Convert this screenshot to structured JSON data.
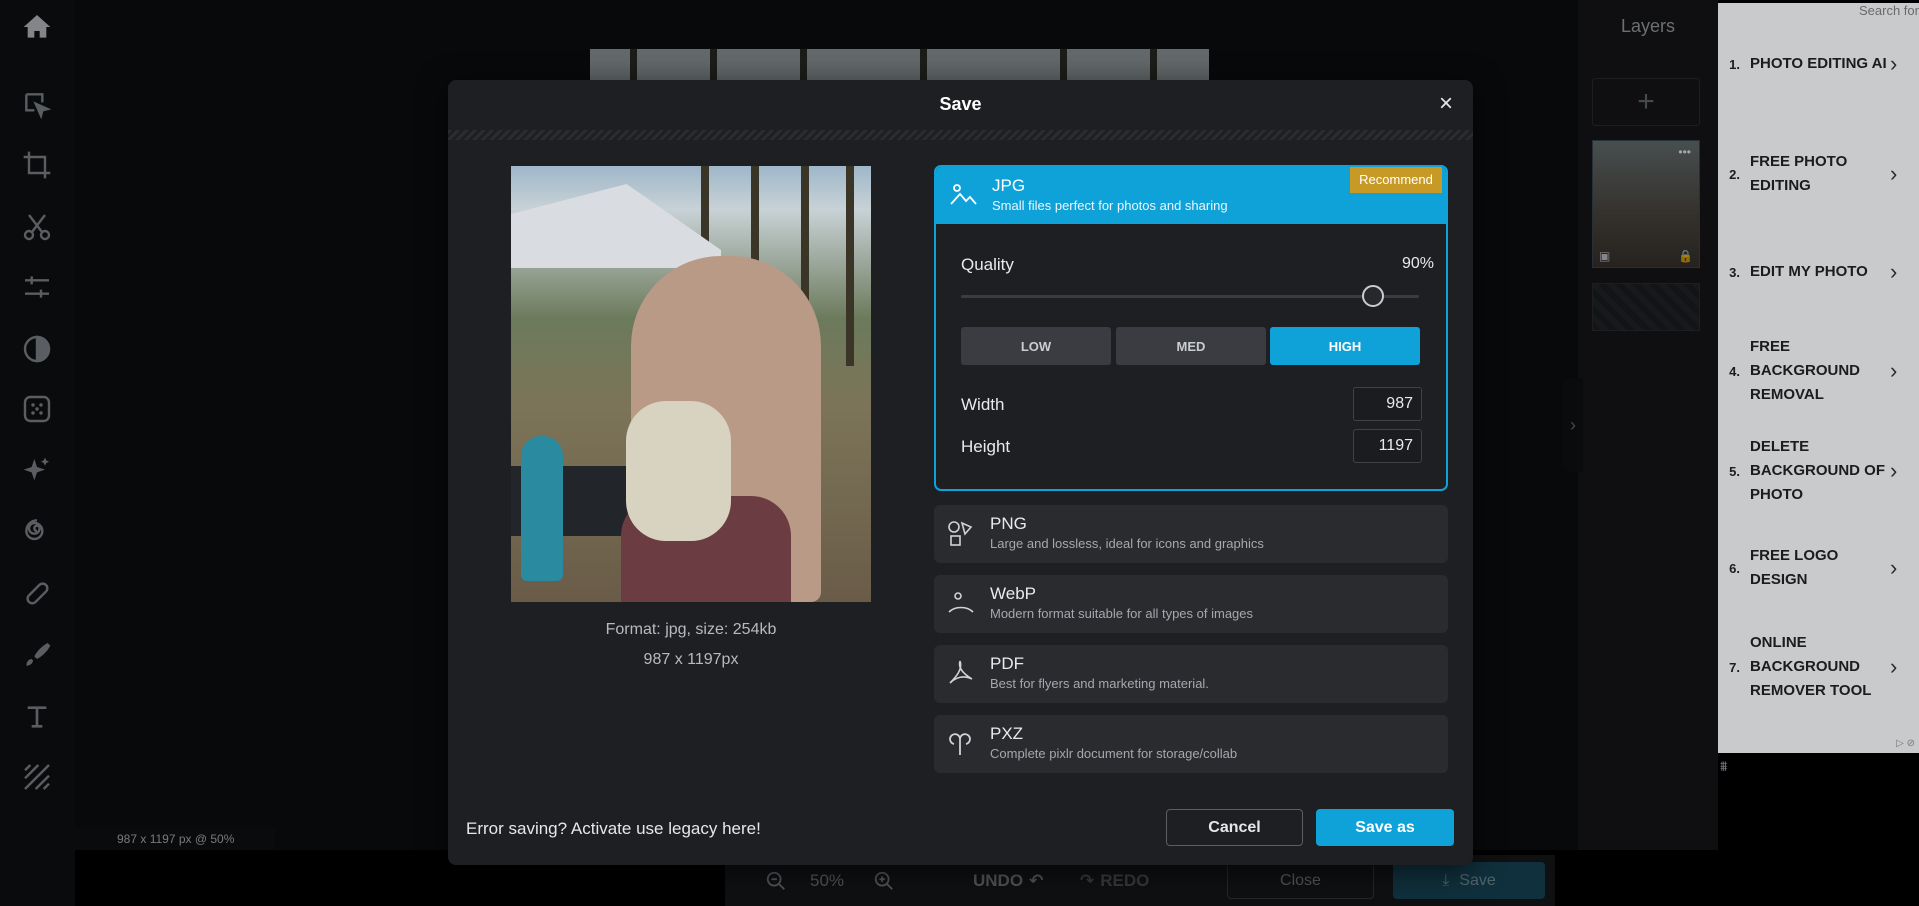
{
  "canvas": {
    "status": "987 x 1197 px @ 50%"
  },
  "bottom_bar": {
    "zoom": "50%",
    "undo": "UNDO",
    "redo": "REDO",
    "close": "Close",
    "save": "Save"
  },
  "layers": {
    "title": "Layers",
    "add": "+",
    "thumb_menu": "•••"
  },
  "ad": {
    "search": "Search for",
    "items": [
      {
        "num": "1.",
        "label": "PHOTO EDITING AI"
      },
      {
        "num": "2.",
        "label": "FREE PHOTO EDITING"
      },
      {
        "num": "3.",
        "label": "EDIT MY PHOTO"
      },
      {
        "num": "4.",
        "label": "FREE BACKGROUND REMOVAL"
      },
      {
        "num": "5.",
        "label": "DELETE BACKGROUND OF PHOTO"
      },
      {
        "num": "6.",
        "label": "FREE LOGO DESIGN"
      },
      {
        "num": "7.",
        "label": "ONLINE BACKGROUND REMOVER TOOL"
      }
    ]
  },
  "dialog": {
    "title": "Save",
    "close": "×",
    "preview": {
      "format_size": "Format: jpg, size: 254kb",
      "dimensions": "987 x 1197px"
    },
    "jpg": {
      "name": "JPG",
      "desc": "Small files perfect for photos and sharing",
      "badge": "Recommend",
      "quality_label": "Quality",
      "quality_value": "90%",
      "quality": 0.9,
      "presets": [
        "LOW",
        "MED",
        "HIGH"
      ],
      "active_preset": "HIGH",
      "width_label": "Width",
      "width": "987",
      "height_label": "Height",
      "height": "1197"
    },
    "formats": [
      {
        "name": "PNG",
        "desc": "Large and lossless, ideal for icons and graphics",
        "icon": "shapes-icon"
      },
      {
        "name": "WebP",
        "desc": "Modern format suitable for all types of images",
        "icon": "webp-icon"
      },
      {
        "name": "PDF",
        "desc": "Best for flyers and marketing material.",
        "icon": "pdf-icon"
      },
      {
        "name": "PXZ",
        "desc": "Complete pixlr document for storage/collab",
        "icon": "pxz-icon"
      }
    ],
    "legacy": "Error saving? Activate use legacy here!",
    "cancel": "Cancel",
    "save_as": "Save as"
  },
  "colors": {
    "accent": "#0fa2d9",
    "badge": "#c79a26",
    "dialog_bg": "#1e1f22"
  }
}
